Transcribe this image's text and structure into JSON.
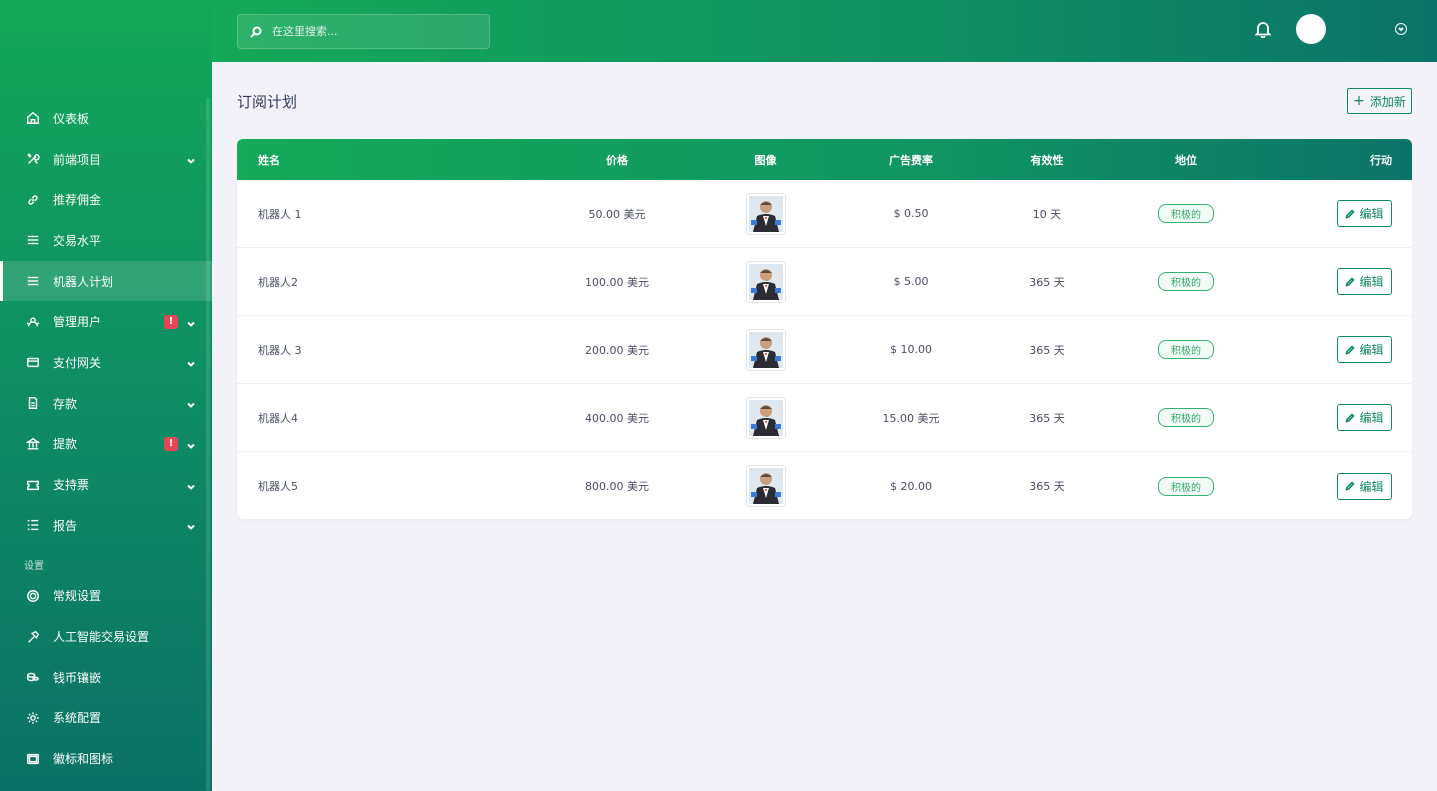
{
  "search": {
    "placeholder": "在这里搜索..."
  },
  "sidebar": {
    "items": [
      {
        "label": "仪表板",
        "icon": "home-icon",
        "chevron": false,
        "alert": false,
        "active": false
      },
      {
        "label": "前端项目",
        "icon": "tools-icon",
        "chevron": true,
        "alert": false,
        "active": false
      },
      {
        "label": "推荐佣金",
        "icon": "link-icon",
        "chevron": false,
        "alert": false,
        "active": false
      },
      {
        "label": "交易水平",
        "icon": "menu-icon",
        "chevron": false,
        "alert": false,
        "active": false
      },
      {
        "label": "机器人计划",
        "icon": "menu-icon",
        "chevron": false,
        "alert": false,
        "active": true
      },
      {
        "label": "管理用户",
        "icon": "users-icon",
        "chevron": true,
        "alert": true,
        "active": false
      },
      {
        "label": "支付网关",
        "icon": "credit-card-icon",
        "chevron": true,
        "alert": false,
        "active": false
      },
      {
        "label": "存款",
        "icon": "file-icon",
        "chevron": true,
        "alert": false,
        "active": false
      },
      {
        "label": "提款",
        "icon": "bank-icon",
        "chevron": true,
        "alert": true,
        "active": false
      },
      {
        "label": "支持票",
        "icon": "ticket-icon",
        "chevron": true,
        "alert": false,
        "active": false
      },
      {
        "label": "报告",
        "icon": "list-icon",
        "chevron": true,
        "alert": false,
        "active": false
      }
    ],
    "settings_title": "设置",
    "settings_items": [
      {
        "label": "常规设置",
        "icon": "life-ring-icon"
      },
      {
        "label": "人工智能交易设置",
        "icon": "hammer-icon"
      },
      {
        "label": "钱币镶嵌",
        "icon": "coins-icon"
      },
      {
        "label": "系统配置",
        "icon": "gear-icon"
      },
      {
        "label": "徽标和图标",
        "icon": "image-icon"
      }
    ],
    "alert_glyph": "!"
  },
  "page": {
    "title": "订阅计划",
    "add_label": "添加新",
    "add_icon": "+"
  },
  "table": {
    "headers": {
      "name": "姓名",
      "price": "价格",
      "image": "图像",
      "rate": "广告费率",
      "validity": "有效性",
      "status": "地位",
      "action": "行动"
    },
    "rows": [
      {
        "name": "机器人 1",
        "price": "50.00 美元",
        "rate": "$ 0.50",
        "validity": "10 天",
        "status": "积极的",
        "action": "编辑"
      },
      {
        "name": "机器人2",
        "price": "100.00 美元",
        "rate": "$ 5.00",
        "validity": "365 天",
        "status": "积极的",
        "action": "编辑"
      },
      {
        "name": "机器人 3",
        "price": "200.00 美元",
        "rate": "$ 10.00",
        "validity": "365 天",
        "status": "积极的",
        "action": "编辑"
      },
      {
        "name": "机器人4",
        "price": "400.00 美元",
        "rate": "15.00 美元",
        "validity": "365 天",
        "status": "积极的",
        "action": "编辑"
      },
      {
        "name": "机器人5",
        "price": "800.00 美元",
        "rate": "$ 20.00",
        "validity": "365 天",
        "status": "积极的",
        "action": "编辑"
      }
    ]
  },
  "colors": {
    "brand_green": "#15a95a",
    "brand_teal": "#0b7467",
    "badge_green": "#2fa863",
    "alert_red": "#e64558"
  }
}
